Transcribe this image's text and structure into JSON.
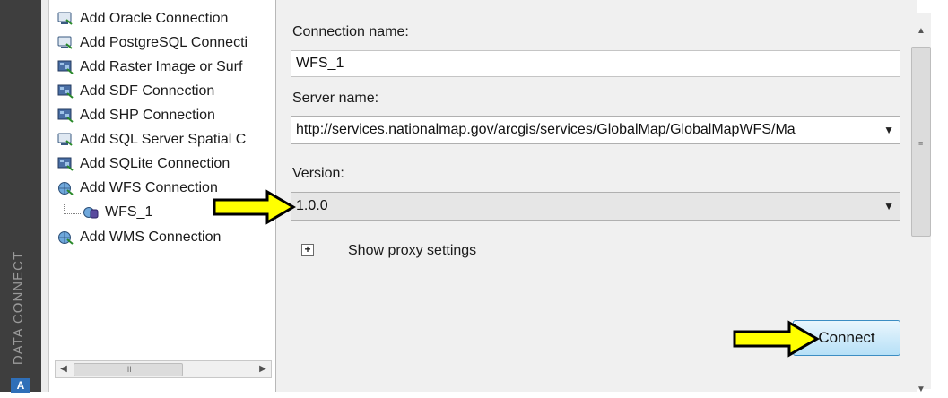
{
  "sidebar": {
    "title": "DATA CONNECT",
    "logo": "A"
  },
  "tree": {
    "items": [
      {
        "label": "Add Oracle Connection",
        "icon": "connection-add-icon"
      },
      {
        "label": "Add PostgreSQL Connecti",
        "icon": "connection-add-icon"
      },
      {
        "label": "Add Raster Image or Surf",
        "icon": "raster-add-icon"
      },
      {
        "label": "Add SDF Connection",
        "icon": "raster-add-icon"
      },
      {
        "label": "Add SHP Connection",
        "icon": "raster-add-icon"
      },
      {
        "label": "Add SQL Server Spatial C",
        "icon": "connection-add-icon"
      },
      {
        "label": "Add SQLite Connection",
        "icon": "raster-add-icon"
      },
      {
        "label": "Add WFS Connection",
        "icon": "globe-add-icon"
      },
      {
        "label": "WFS_1",
        "icon": "globe-connection-icon"
      },
      {
        "label": "Add WMS Connection",
        "icon": "globe-add-icon"
      }
    ],
    "scroll_grip": "III"
  },
  "form": {
    "connection_name_label": "Connection name:",
    "connection_name_value": "WFS_1",
    "server_name_label": "Server name:",
    "server_name_value": "http://services.nationalmap.gov/arcgis/services/GlobalMap/GlobalMapWFS/Ma",
    "version_label": "Version:",
    "version_value": "1.0.0",
    "proxy_toggle": "+",
    "proxy_label": "Show proxy settings",
    "connect_label": "Connect"
  },
  "colors": {
    "arrow_fill": "#ffff00",
    "arrow_stroke": "#000000",
    "sidebar_bg": "#3e3e3e"
  }
}
